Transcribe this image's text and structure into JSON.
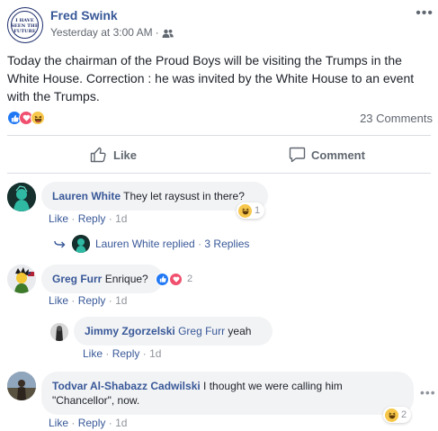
{
  "post": {
    "author": "Fred Swink",
    "page_logo_text": "I HAVE SEEN THE FUTURE",
    "timestamp": "Yesterday at 3:00 AM",
    "separator": "·",
    "text": "Today the chairman of the Proud Boys will be visiting the Trumps in the White House. Correction : he was invited by the White House to an event with the Trumps.",
    "reactions": [
      "like",
      "love",
      "haha"
    ],
    "comments_count": "23 Comments",
    "more_icon": "more-horizontal-icon",
    "audience_icon": "friends-icon"
  },
  "actions": {
    "like_label": "Like",
    "comment_label": "Comment"
  },
  "comments": [
    {
      "name": "Lauren White",
      "text": "They let raysust in there?",
      "like": "Like",
      "reply": "Reply",
      "time": "1d",
      "reaction_count": "1",
      "replied_by": "Lauren White replied",
      "replies_label": "3 Replies"
    },
    {
      "name": "Greg Furr",
      "text": "Enrique?",
      "like": "Like",
      "reply": "Reply",
      "time": "1d",
      "reaction_count": "2"
    },
    {
      "name": "Jimmy Zgorzelski",
      "mention": "Greg Furr",
      "text": "yeah",
      "like": "Like",
      "reply": "Reply",
      "time": "1d"
    },
    {
      "name": "Todvar Al-Shabazz Cadwilski",
      "text": "I thought we were calling him \"Chancellor\", now.",
      "like": "Like",
      "reply": "Reply",
      "time": "1d",
      "reaction_count": "2"
    }
  ],
  "colors": {
    "link": "#385898",
    "like_blue": "#2078f4",
    "love_red": "#f0506e",
    "haha_yellow": "#f7c74b",
    "bubble_bg": "#f2f3f5",
    "muted": "#90949c"
  }
}
